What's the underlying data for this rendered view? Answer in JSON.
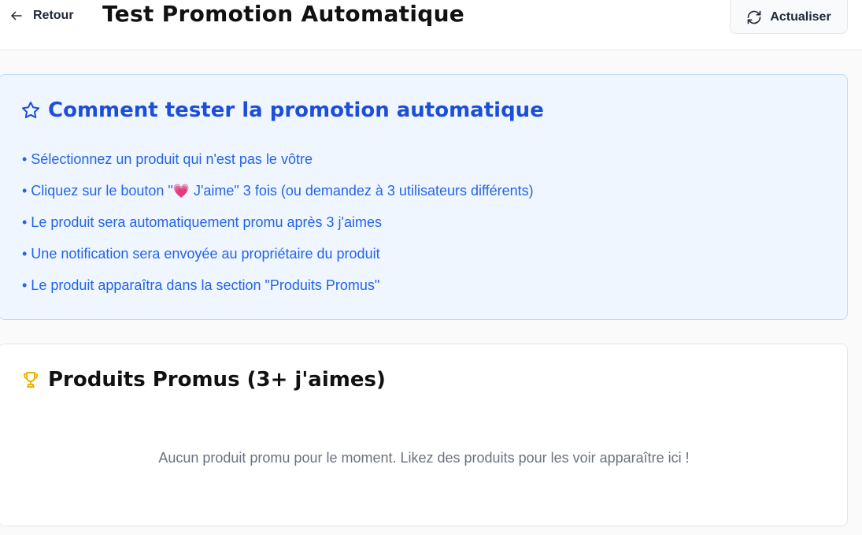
{
  "header": {
    "back_label": "Retour",
    "title": "Test Promotion Automatique",
    "refresh_label": "Actualiser"
  },
  "info": {
    "title": "Comment tester la promotion automatique",
    "items": [
      {
        "text": "• Sélectionnez un produit qui n'est pas le vôtre"
      },
      {
        "before": "• Cliquez sur le bouton \"",
        "emoji": "💗",
        "after": " J'aime\" 3 fois (ou demandez à 3 utilisateurs différents)"
      },
      {
        "text": "• Le produit sera automatiquement promu après 3 j'aimes"
      },
      {
        "text": "• Une notification sera envoyée au propriétaire du produit"
      },
      {
        "text": "• Le produit apparaîtra dans la section \"Produits Promus\""
      }
    ]
  },
  "promoted": {
    "title": "Produits Promus (3+ j'aimes)",
    "empty_message": "Aucun produit promu pour le moment. Likez des produits pour les voir apparaître ici !"
  },
  "icons": {
    "back": "arrow-left-icon",
    "refresh": "refresh-icon",
    "star": "star-icon",
    "trophy": "trophy-icon",
    "heart": "heart-icon"
  },
  "colors": {
    "accent_blue": "#1d4ed8",
    "list_blue": "#2563eb",
    "info_bg": "#eff6ff",
    "info_border": "#bfdbfe",
    "trophy": "#eab308",
    "heart": "#e11d48",
    "muted_text": "#6b7280"
  }
}
